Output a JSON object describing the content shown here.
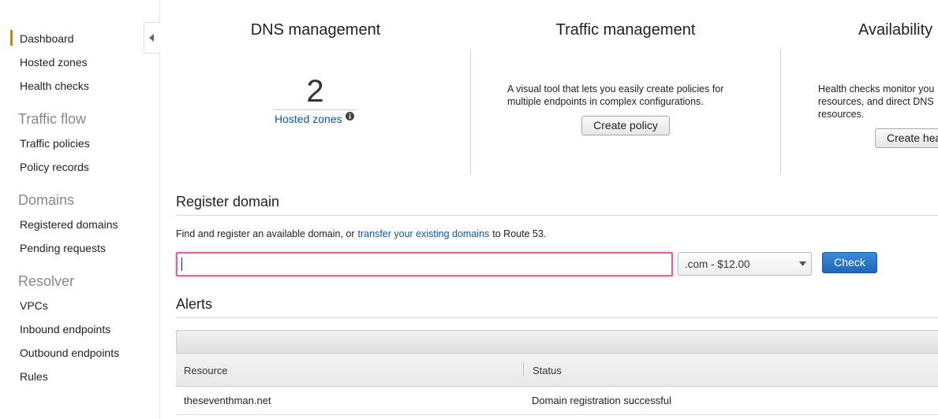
{
  "sidebar": {
    "items": [
      {
        "label": "Dashboard",
        "active": true
      },
      {
        "label": "Hosted zones"
      },
      {
        "label": "Health checks"
      },
      {
        "heading": "Traffic flow"
      },
      {
        "label": "Traffic policies"
      },
      {
        "label": "Policy records"
      },
      {
        "heading": "Domains"
      },
      {
        "label": "Registered domains"
      },
      {
        "label": "Pending requests"
      },
      {
        "heading": "Resolver"
      },
      {
        "label": "VPCs"
      },
      {
        "label": "Inbound endpoints"
      },
      {
        "label": "Outbound endpoints"
      },
      {
        "label": "Rules"
      }
    ]
  },
  "panels": {
    "dns": {
      "title": "DNS management",
      "count": "2",
      "link": "Hosted zones"
    },
    "traffic": {
      "title": "Traffic management",
      "description_line1": "A visual tool that lets you easily create policies for",
      "description_line2": "multiple endpoints in complex configurations.",
      "button": "Create policy"
    },
    "availability": {
      "title": "Availability",
      "description_line1": "Health checks monitor you",
      "description_line2": "resources, and direct DNS",
      "description_line3": "resources.",
      "button": "Create hea"
    }
  },
  "register": {
    "title": "Register domain",
    "text_before": "Find and register an available domain, or",
    "link": "transfer your existing domains",
    "text_after": "to Route 53.",
    "input_value": "",
    "tld_selected": ".com - $12.00",
    "check_button": "Check"
  },
  "alerts": {
    "title": "Alerts",
    "columns": [
      "Resource",
      "Status"
    ],
    "rows": [
      {
        "resource": "theseventhman.net",
        "status": "Domain registration successful"
      }
    ]
  },
  "colors": {
    "accent": "#e07b12",
    "link": "#0a57a6",
    "primary_button": "#1f67bb",
    "focus": "#e75fa0"
  }
}
